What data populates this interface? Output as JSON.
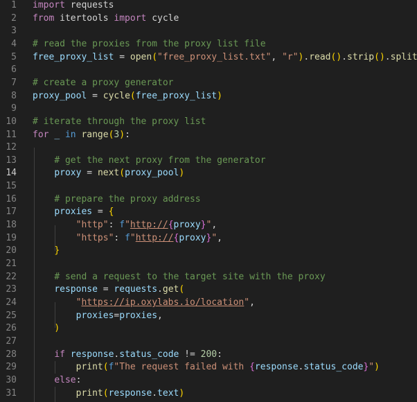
{
  "editor": {
    "active_line": 14,
    "colors": {
      "background": "#1f1f1f",
      "keyword": "#c586c0",
      "variable": "#9cdcfe",
      "function": "#dcdcaa",
      "string": "#ce9178",
      "comment": "#6a9955",
      "number": "#b5cea8",
      "bracket_1": "#ffd700",
      "bracket_2": "#da70d6",
      "bracket_3": "#179fff"
    },
    "lines": [
      {
        "num": "1",
        "tokens": [
          [
            "kw",
            "import"
          ],
          [
            "def",
            " requests"
          ]
        ]
      },
      {
        "num": "2",
        "tokens": [
          [
            "kw",
            "from"
          ],
          [
            "def",
            " itertools "
          ],
          [
            "kw",
            "import"
          ],
          [
            "def",
            " cycle"
          ]
        ]
      },
      {
        "num": "3",
        "tokens": []
      },
      {
        "num": "4",
        "tokens": [
          [
            "com",
            "# read the proxies from the proxy list file"
          ]
        ]
      },
      {
        "num": "5",
        "tokens": [
          [
            "var",
            "free_proxy_list"
          ],
          [
            "op",
            " = "
          ],
          [
            "fn",
            "open"
          ],
          [
            "b1",
            "("
          ],
          [
            "str",
            "\"free_proxy_list.txt\""
          ],
          [
            "def",
            ", "
          ],
          [
            "str",
            "\"r\""
          ],
          [
            "b1",
            ")"
          ],
          [
            "def",
            "."
          ],
          [
            "fn",
            "read"
          ],
          [
            "b1",
            "("
          ],
          [
            "b1",
            ")"
          ],
          [
            "def",
            "."
          ],
          [
            "fn",
            "strip"
          ],
          [
            "b1",
            "("
          ],
          [
            "b1",
            ")"
          ],
          [
            "def",
            "."
          ],
          [
            "fn",
            "split"
          ],
          [
            "b1",
            "("
          ],
          [
            "str",
            "\"\\"
          ]
        ]
      },
      {
        "num": "6",
        "tokens": []
      },
      {
        "num": "7",
        "tokens": [
          [
            "com",
            "# create a proxy generator"
          ]
        ]
      },
      {
        "num": "8",
        "tokens": [
          [
            "var",
            "proxy_pool"
          ],
          [
            "op",
            " = "
          ],
          [
            "fn",
            "cycle"
          ],
          [
            "b1",
            "("
          ],
          [
            "var",
            "free_proxy_list"
          ],
          [
            "b1",
            ")"
          ]
        ]
      },
      {
        "num": "9",
        "tokens": []
      },
      {
        "num": "10",
        "tokens": [
          [
            "com",
            "# iterate through the proxy list"
          ]
        ]
      },
      {
        "num": "11",
        "tokens": [
          [
            "kw",
            "for"
          ],
          [
            "def",
            " "
          ],
          [
            "var",
            "_"
          ],
          [
            "def",
            " "
          ],
          [
            "kw2",
            "in"
          ],
          [
            "def",
            " "
          ],
          [
            "fn",
            "range"
          ],
          [
            "b1",
            "("
          ],
          [
            "num",
            "3"
          ],
          [
            "b1",
            ")"
          ],
          [
            "def",
            ":"
          ]
        ]
      },
      {
        "num": "12",
        "tokens": []
      },
      {
        "num": "13",
        "tokens": [
          [
            "def",
            "    "
          ],
          [
            "com",
            "# get the next proxy from the generator"
          ]
        ]
      },
      {
        "num": "14",
        "tokens": [
          [
            "def",
            "    "
          ],
          [
            "var",
            "proxy"
          ],
          [
            "op",
            " = "
          ],
          [
            "fn",
            "next"
          ],
          [
            "b1",
            "("
          ],
          [
            "var",
            "proxy_pool"
          ],
          [
            "b1",
            ")"
          ]
        ]
      },
      {
        "num": "15",
        "tokens": []
      },
      {
        "num": "16",
        "tokens": [
          [
            "def",
            "    "
          ],
          [
            "com",
            "# prepare the proxy address"
          ]
        ]
      },
      {
        "num": "17",
        "tokens": [
          [
            "def",
            "    "
          ],
          [
            "var",
            "proxies"
          ],
          [
            "op",
            " = "
          ],
          [
            "b1",
            "{"
          ]
        ]
      },
      {
        "num": "18",
        "tokens": [
          [
            "def",
            "        "
          ],
          [
            "str",
            "\"http\""
          ],
          [
            "def",
            ": "
          ],
          [
            "kw2",
            "f"
          ],
          [
            "str",
            "\""
          ],
          [
            "url",
            "http://"
          ],
          [
            "b2",
            "{"
          ],
          [
            "var",
            "proxy"
          ],
          [
            "b2",
            "}"
          ],
          [
            "str",
            "\""
          ],
          [
            "def",
            ","
          ]
        ]
      },
      {
        "num": "19",
        "tokens": [
          [
            "def",
            "        "
          ],
          [
            "str",
            "\"https\""
          ],
          [
            "def",
            ": "
          ],
          [
            "kw2",
            "f"
          ],
          [
            "str",
            "\""
          ],
          [
            "url",
            "http://"
          ],
          [
            "b2",
            "{"
          ],
          [
            "var",
            "proxy"
          ],
          [
            "b2",
            "}"
          ],
          [
            "str",
            "\""
          ],
          [
            "def",
            ","
          ]
        ]
      },
      {
        "num": "20",
        "tokens": [
          [
            "def",
            "    "
          ],
          [
            "b1",
            "}"
          ]
        ]
      },
      {
        "num": "21",
        "tokens": []
      },
      {
        "num": "22",
        "tokens": [
          [
            "def",
            "    "
          ],
          [
            "com",
            "# send a request to the target site with the proxy"
          ]
        ]
      },
      {
        "num": "23",
        "tokens": [
          [
            "def",
            "    "
          ],
          [
            "var",
            "response"
          ],
          [
            "op",
            " = "
          ],
          [
            "var",
            "requests"
          ],
          [
            "def",
            "."
          ],
          [
            "fn",
            "get"
          ],
          [
            "b1",
            "("
          ]
        ]
      },
      {
        "num": "24",
        "tokens": [
          [
            "def",
            "        "
          ],
          [
            "str",
            "\""
          ],
          [
            "url",
            "https://ip.oxylabs.io/location"
          ],
          [
            "str",
            "\""
          ],
          [
            "def",
            ","
          ]
        ]
      },
      {
        "num": "25",
        "tokens": [
          [
            "def",
            "        "
          ],
          [
            "var",
            "proxies"
          ],
          [
            "op",
            "="
          ],
          [
            "var",
            "proxies"
          ],
          [
            "def",
            ","
          ]
        ]
      },
      {
        "num": "26",
        "tokens": [
          [
            "def",
            "    "
          ],
          [
            "b1",
            ")"
          ]
        ]
      },
      {
        "num": "27",
        "tokens": []
      },
      {
        "num": "28",
        "tokens": [
          [
            "def",
            "    "
          ],
          [
            "kw",
            "if"
          ],
          [
            "def",
            " "
          ],
          [
            "var",
            "response"
          ],
          [
            "def",
            "."
          ],
          [
            "var",
            "status_code"
          ],
          [
            "op",
            " != "
          ],
          [
            "num",
            "200"
          ],
          [
            "def",
            ":"
          ]
        ]
      },
      {
        "num": "29",
        "tokens": [
          [
            "def",
            "        "
          ],
          [
            "fn",
            "print"
          ],
          [
            "b1",
            "("
          ],
          [
            "kw2",
            "f"
          ],
          [
            "str",
            "\"The request failed with "
          ],
          [
            "b2",
            "{"
          ],
          [
            "var",
            "response"
          ],
          [
            "def",
            "."
          ],
          [
            "var",
            "status_code"
          ],
          [
            "b2",
            "}"
          ],
          [
            "str",
            "\""
          ],
          [
            "b1",
            ")"
          ]
        ]
      },
      {
        "num": "30",
        "tokens": [
          [
            "def",
            "    "
          ],
          [
            "kw",
            "else"
          ],
          [
            "def",
            ":"
          ]
        ]
      },
      {
        "num": "31",
        "tokens": [
          [
            "def",
            "        "
          ],
          [
            "fn",
            "print"
          ],
          [
            "b1",
            "("
          ],
          [
            "var",
            "response"
          ],
          [
            "def",
            "."
          ],
          [
            "var",
            "text"
          ],
          [
            "b1",
            ")"
          ]
        ]
      }
    ]
  }
}
